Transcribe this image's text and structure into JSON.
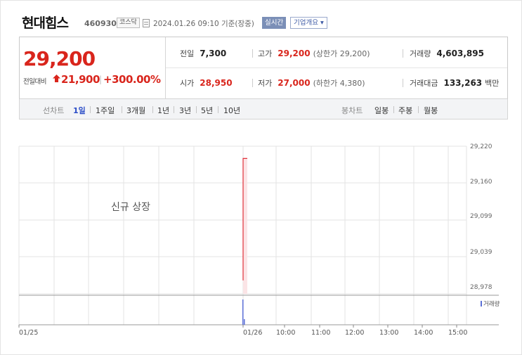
{
  "header": {
    "stock_name": "현대힘스",
    "stock_code": "460930",
    "market": "코스닥",
    "doc_icon": "document-icon",
    "timestamp": "2024.01.26 09:10 기준(장중)",
    "realtime_label": "실시간",
    "overview_label": "기업개요 ▾"
  },
  "quote": {
    "price": "29,200",
    "change_label": "전일대비",
    "change_icon": "up-arrow-icon",
    "change_value": "21,900",
    "change_rate": "+300.00%",
    "up_color": "#d9251c",
    "stats": {
      "prev_close": {
        "label": "전일",
        "value": "7,300"
      },
      "high": {
        "label": "고가",
        "value": "29,200",
        "sub": "(상한가 29,200)"
      },
      "volume": {
        "label": "거래량",
        "value": "4,603,895"
      },
      "open": {
        "label": "시가",
        "value": "28,950"
      },
      "low": {
        "label": "저가",
        "value": "27,000",
        "sub": "(하한가 4,380)"
      },
      "trade_value": {
        "label": "거래대금",
        "value": "133,263",
        "unit": "백만"
      }
    }
  },
  "tabs": {
    "line_label": "선차트",
    "periods": [
      "1일",
      "1주일",
      "3개월",
      "1년",
      "3년",
      "5년",
      "10년"
    ],
    "active_period": "1일",
    "candle_label": "봉차트",
    "candles": [
      "일봉",
      "주봉",
      "월봉"
    ],
    "active_color": "#2a4cc7"
  },
  "chart": {
    "note": "신규 상장",
    "volume_legend": "거래량",
    "volume_color": "#5b6fd6",
    "line_color": "#e0303a"
  },
  "chart_data": {
    "type": "line",
    "y_ticks": [
      "29,220",
      "29,160",
      "29,099",
      "29,039",
      "28,978"
    ],
    "ylim": [
      28978,
      29220
    ],
    "x_ticks": [
      "01/25",
      "01/26",
      "10:00",
      "11:00",
      "12:00",
      "13:00",
      "14:00",
      "15:00"
    ],
    "series": [
      {
        "x": [
          "09:00",
          "09:00",
          "09:10"
        ],
        "y": [
          29000,
          29200,
          29200
        ]
      }
    ],
    "grid": true
  }
}
